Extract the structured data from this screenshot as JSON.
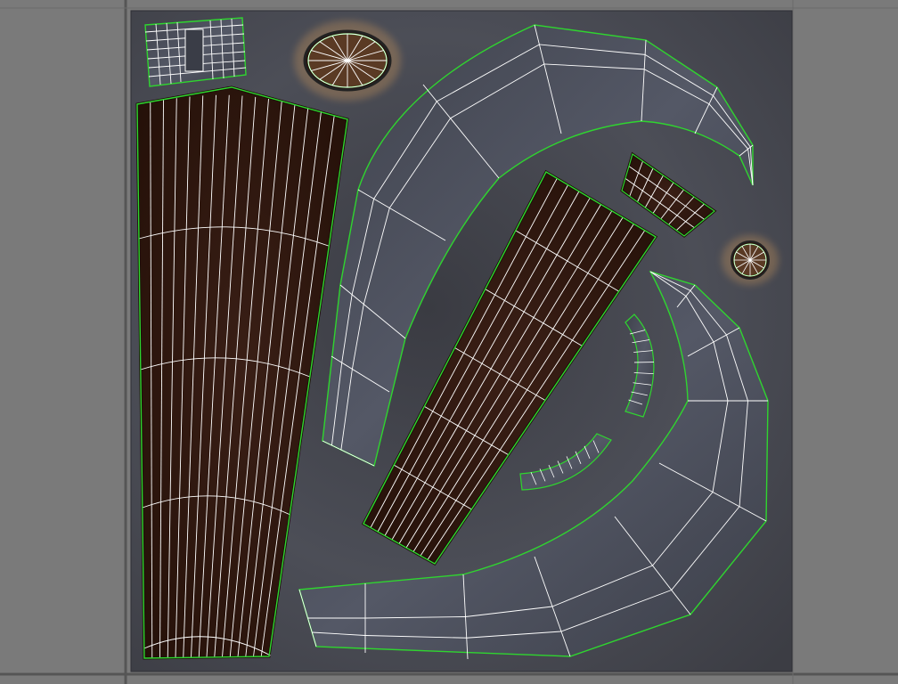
{
  "viewport": {
    "background_color": "#7a7a7a",
    "grid_line_color": "#555555"
  },
  "uv_tile": {
    "gradient_center_color": "#3b3c44",
    "gradient_edge_color": "#474953",
    "border_color": "#2e2f35"
  },
  "colors": {
    "island_boundary": "#2fd52f",
    "wire": "#ffffff",
    "dark_face": "#2a1410",
    "light_face": "#4a4d58",
    "glow": "#ffc27a"
  },
  "islands": [
    {
      "id": "shin-panel",
      "kind": "dark"
    },
    {
      "id": "thigh-panel",
      "kind": "dark"
    },
    {
      "id": "upper-crescent",
      "kind": "light"
    },
    {
      "id": "lower-crescent",
      "kind": "light"
    },
    {
      "id": "top-left-cap",
      "kind": "light"
    },
    {
      "id": "oval-disc",
      "kind": "dark"
    },
    {
      "id": "small-disc",
      "kind": "dark"
    },
    {
      "id": "arc-strip-upper",
      "kind": "dark"
    },
    {
      "id": "inner-arc-right",
      "kind": "light"
    },
    {
      "id": "inner-arc-bottom",
      "kind": "light"
    }
  ]
}
